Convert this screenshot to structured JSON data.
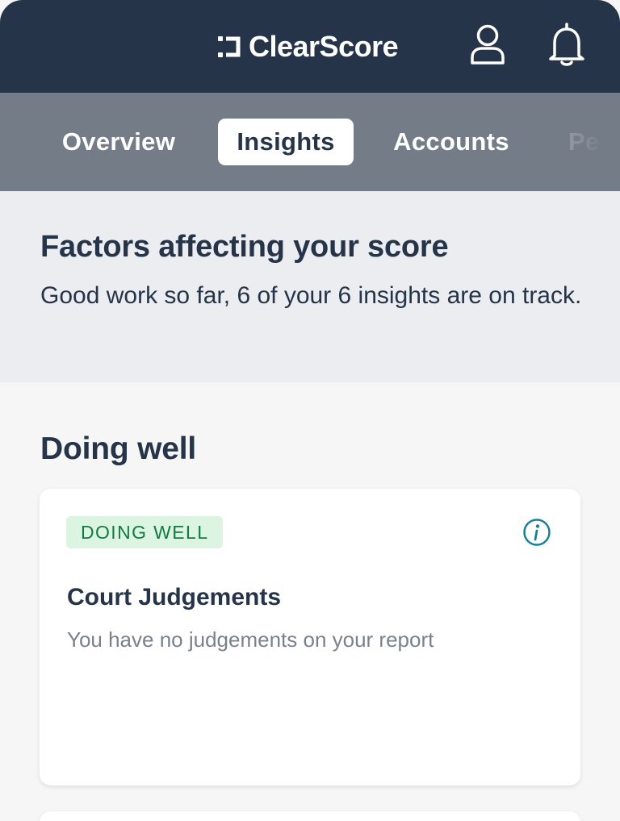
{
  "app": {
    "brand_name": "ClearScore",
    "brand_color": "#253448",
    "icons": {
      "logo": "clearscore-logo-icon",
      "profile": "user-icon",
      "notifications": "bell-icon"
    }
  },
  "tabs": [
    {
      "label": "Overview",
      "active": false
    },
    {
      "label": "Insights",
      "active": true
    },
    {
      "label": "Accounts",
      "active": false
    },
    {
      "label": "Pe",
      "active": false
    }
  ],
  "factors": {
    "title": "Factors affecting your score",
    "subtitle": "Good work so far, 6 of your 6 insights are on track."
  },
  "section": {
    "title": "Doing well"
  },
  "cards": [
    {
      "badge": "DOING WELL",
      "badge_color": "#137a42",
      "title": "Court Judgements",
      "description": "You have no judgements on your report",
      "icon": "info-icon"
    }
  ]
}
